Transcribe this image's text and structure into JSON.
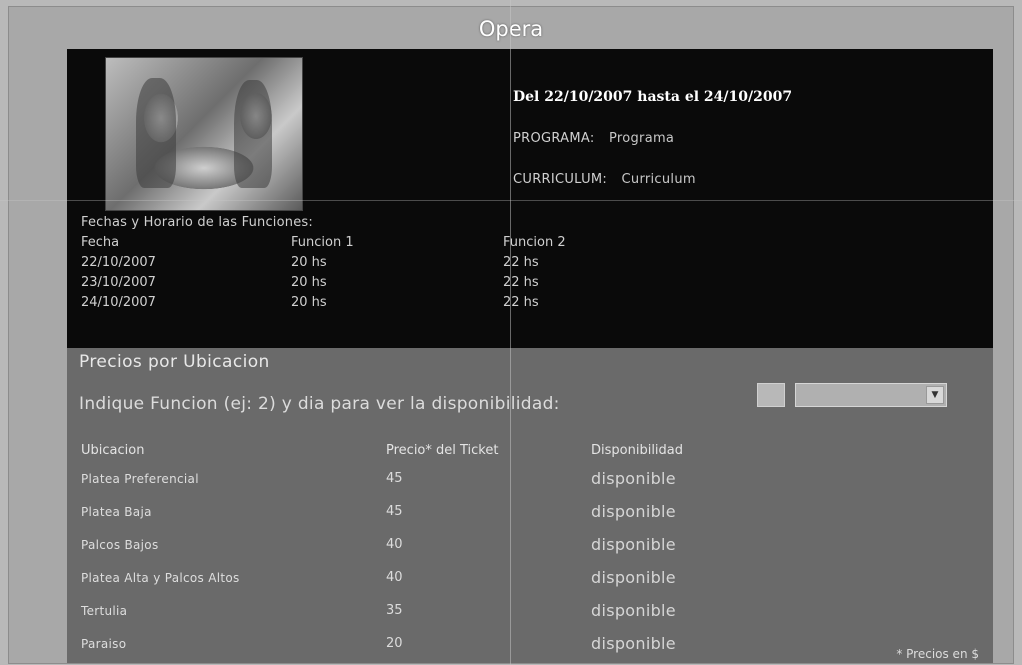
{
  "page": {
    "title": "Opera"
  },
  "event": {
    "date_range": "Del 22/10/2007 hasta el 24/10/2007",
    "programa_label": "PROGRAMA:",
    "programa_link": "Programa",
    "curriculum_label": "CURRICULUM:",
    "curriculum_link": "Curriculum"
  },
  "schedule": {
    "heading": "Fechas y Horario de las Funciones:",
    "columns": [
      "Fecha",
      "Funcion 1",
      "Funcion 2"
    ],
    "rows": [
      [
        "22/10/2007",
        "20 hs",
        "22 hs"
      ],
      [
        "23/10/2007",
        "20 hs",
        "22 hs"
      ],
      [
        "24/10/2007",
        "20 hs",
        "22 hs"
      ]
    ]
  },
  "prices": {
    "title": "Precios por Ubicacion",
    "instructions": "Indique Funcion (ej: 2) y dia para ver la disponibilidad:",
    "function_input_value": "",
    "day_select_value": "",
    "columns": [
      "Ubicacion",
      "Precio* del Ticket",
      "Disponibilidad"
    ],
    "rows": [
      [
        "Platea Preferencial",
        "45",
        "disponible"
      ],
      [
        "Platea Baja",
        "45",
        "disponible"
      ],
      [
        "Palcos Bajos",
        "40",
        "disponible"
      ],
      [
        "Platea Alta y Palcos Altos",
        "40",
        "disponible"
      ],
      [
        "Tertulia",
        "35",
        "disponible"
      ],
      [
        "Paraiso",
        "20",
        "disponible"
      ]
    ],
    "footnote": "* Precios en $"
  }
}
